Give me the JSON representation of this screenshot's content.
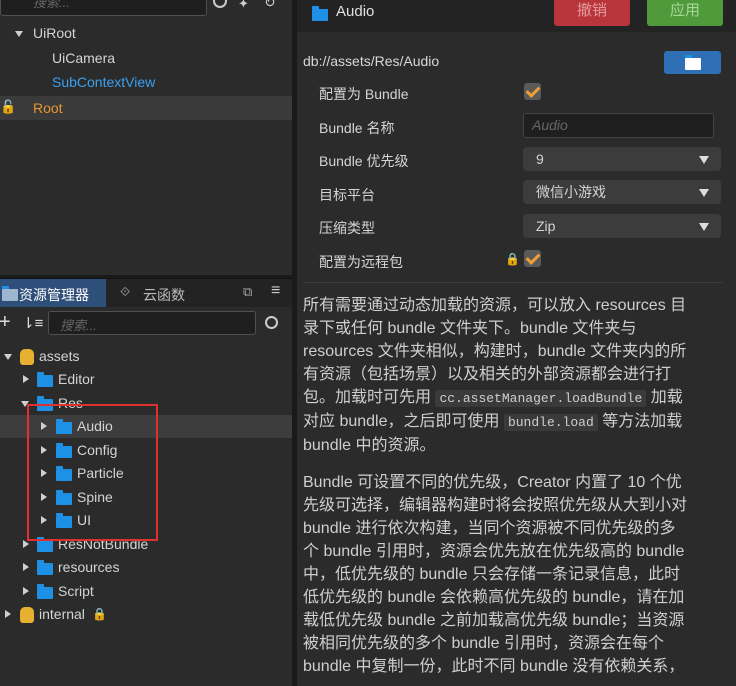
{
  "top_left": {
    "search_placeholder": "搜索...",
    "tree": [
      {
        "label": "UiRoot"
      },
      {
        "label": "UiCamera"
      },
      {
        "label": "SubContextView"
      },
      {
        "label": "Root"
      }
    ]
  },
  "assets_panel": {
    "tab_assets": "资源管理器",
    "tab_cloud": "云函数",
    "search_placeholder": "搜索...",
    "tree": {
      "assets": "assets",
      "editor": "Editor",
      "res": "Res",
      "audio": "Audio",
      "config": "Config",
      "particle": "Particle",
      "spine": "Spine",
      "ui": "UI",
      "resnotbundle": "ResNotBundle",
      "resources": "resources",
      "script": "Script",
      "internal": "internal"
    },
    "highlight_color": "#e03131"
  },
  "inspector": {
    "title": "Audio",
    "revert_label": "撤销",
    "apply_label": "应用",
    "path": "db://assets/Res/Audio",
    "props": {
      "is_bundle_label": "配置为 Bundle",
      "bundle_name_label": "Bundle 名称",
      "bundle_name_placeholder": "Audio",
      "priority_label": "Bundle 优先级",
      "priority_value": "9",
      "platform_label": "目标平台",
      "platform_value": "微信小游戏",
      "compression_label": "压缩类型",
      "compression_value": "Zip",
      "remote_label": "配置为远程包"
    },
    "doc1": {
      "line1": "所有需要通过动态加载的资源，可以放入 resources 目",
      "line2": "录下或任何 bundle 文件夹下。bundle 文件夹与",
      "line3": "resources 文件夹相似，构建时，bundle 文件夹内的所",
      "line4": "有资源（包括场景）以及相关的外部资源都会进行打",
      "line5a": "包。加载时可先用 ",
      "code1": "cc.assetManager.loadBundle",
      "line5b": " 加载",
      "line6a": "对应 bundle，之后即可使用 ",
      "code2": "bundle.load",
      "line6b": " 等方法加载",
      "line7": "bundle 中的资源。"
    },
    "doc2": [
      "Bundle 可设置不同的优先级，Creator 内置了 10 个优",
      "先级可选择，编辑器构建时将会按照优先级从大到小对",
      "bundle 进行依次构建，当同个资源被不同优先级的多",
      "个 bundle 引用时，资源会优先放在优先级高的 bundle",
      "中，低优先级的 bundle 只会存储一条记录信息，此时",
      "低优先级的 bundle 会依赖高优先级的 bundle，请在加",
      "载低优先级 bundle 之前加载高优先级 bundle；当资源",
      "被相同优先级的多个 bundle 引用时，资源会在每个",
      "bundle 中复制一份，此时不同 bundle 没有依赖关系，"
    ]
  }
}
